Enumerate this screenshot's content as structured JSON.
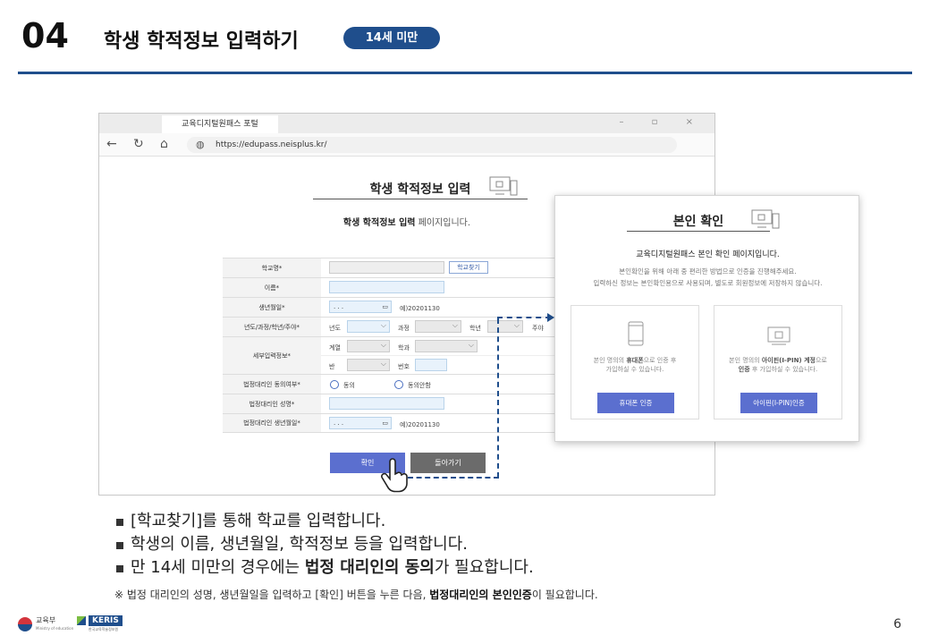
{
  "slide": {
    "number": "04",
    "title": "학생 학적정보 입력하기",
    "badge": "14세 미만",
    "page_number": "6"
  },
  "colors": {
    "accent": "#1f4e8c",
    "button": "#5b6fcf",
    "back_button": "#6b6b6b"
  },
  "browser": {
    "tab_title": "교육디지털원패스 포털",
    "window_controls": "–  ▫  ×",
    "url": "https://edupass.neisplus.kr/",
    "icons": [
      "back-icon",
      "refresh-icon",
      "home-icon",
      "globe-icon"
    ]
  },
  "page": {
    "heading": "학생 학적정보 입력",
    "sub_bold": "학생 학적정보 입력",
    "sub_rest": " 페이지입니다."
  },
  "form": {
    "school_label": "학교명*",
    "school_button": "학교찾기",
    "name_label": "이름*",
    "birth_label": "생년월일*",
    "date_placeholder": ". . .",
    "date_example": "예)20201130",
    "year_label": "년도/과정/학년/주야*",
    "year_opts": {
      "year": "년도",
      "course": "과정",
      "grade": "학년",
      "daynight": "주야"
    },
    "detail_label": "세부입력정보*",
    "detail_opts": {
      "series": "계열",
      "dept": "학과",
      "class": "반",
      "number": "번호"
    },
    "consent_label": "법정대리인 동의여부*",
    "consent_agree": "동의",
    "consent_disagree": "동의안함",
    "guardian_name_label": "법정대리인 성명*",
    "guardian_birth_label": "법정대리인 생년월일*",
    "confirm_button": "확인",
    "back_button": "돌아가기"
  },
  "popup": {
    "title": "본인 확인",
    "subtitle": "교육디지털원패스 본인 확인 페이지입니다.",
    "desc1": "본인확인을 위해 아래 중 편리한 방법으로 인증을 진행해주세요.",
    "desc2": "입력하신 정보는 본인확인용으로 사용되며, 별도로 회원정보에 저장하지 않습니다.",
    "phone_card": {
      "text_pre": "본인 명의의 ",
      "text_bold": "휴대폰",
      "text_post": "으로 인증 후",
      "text_line2": "가입하실 수 있습니다.",
      "button": "휴대폰 인증"
    },
    "ipin_card": {
      "text_pre": "본인 명의의 ",
      "text_bold": "아이핀(I-PIN) 계정",
      "text_post": "으로",
      "text_line2_bold": "인증",
      "text_line2": " 후 가입하실 수 있습니다.",
      "button": "아이핀(I-PIN)인증"
    }
  },
  "bullets": [
    {
      "pre": "[학교찾기]를 통해 학교를 입력합니다.",
      "bold": "",
      "post": ""
    },
    {
      "pre": "학생의 이름, 생년월일, 학적정보 등을 입력합니다.",
      "bold": "",
      "post": ""
    },
    {
      "pre": "만 14세 미만의 경우에는 ",
      "bold": "법정 대리인의 동의",
      "post": "가 필요합니다."
    }
  ],
  "note": {
    "pre": "※ 법정 대리인의 성명, 생년월일을 입력하고 [확인] 버튼을 누른 다음, ",
    "bold": "법정대리인의 본인인증",
    "post": "이 필요합니다."
  },
  "footer": {
    "moe_name": "교육부",
    "moe_sub": "Ministry of education",
    "keris": "KERIS",
    "keris_sub": "한국교육학술정보원"
  }
}
